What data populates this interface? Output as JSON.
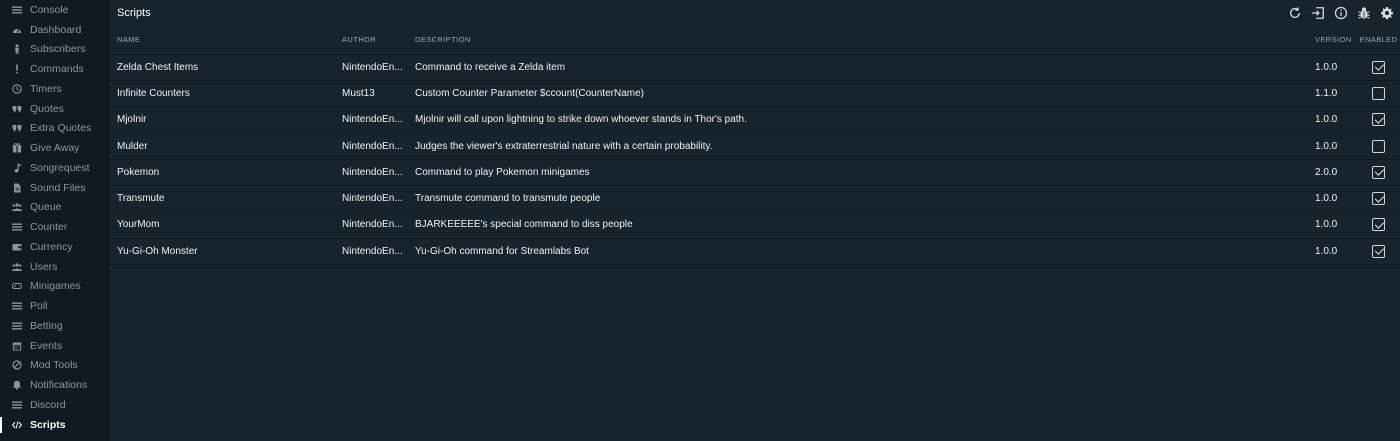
{
  "sidebar": {
    "items": [
      {
        "label": "Console",
        "icon": "menu-icon",
        "active": false
      },
      {
        "label": "Dashboard",
        "icon": "dashboard-icon",
        "active": false
      },
      {
        "label": "Subscribers",
        "icon": "person-icon",
        "active": false
      },
      {
        "label": "Commands",
        "icon": "exclamation-icon",
        "active": false
      },
      {
        "label": "Timers",
        "icon": "clock-icon",
        "active": false
      },
      {
        "label": "Quotes",
        "icon": "quote-icon",
        "active": false
      },
      {
        "label": "Extra Quotes",
        "icon": "quote-icon",
        "active": false
      },
      {
        "label": "Give Away",
        "icon": "gift-icon",
        "active": false
      },
      {
        "label": "Songrequest",
        "icon": "music-note-icon",
        "active": false
      },
      {
        "label": "Sound Files",
        "icon": "file-icon",
        "active": false
      },
      {
        "label": "Queue",
        "icon": "group-icon",
        "active": false
      },
      {
        "label": "Counter",
        "icon": "menu-icon",
        "active": false
      },
      {
        "label": "Currency",
        "icon": "wallet-icon",
        "active": false
      },
      {
        "label": "Users",
        "icon": "group-icon",
        "active": false
      },
      {
        "label": "Minigames",
        "icon": "gamepad-icon",
        "active": false
      },
      {
        "label": "Poll",
        "icon": "menu-icon",
        "active": false
      },
      {
        "label": "Betting",
        "icon": "menu-icon",
        "active": false
      },
      {
        "label": "Events",
        "icon": "calendar-icon",
        "active": false
      },
      {
        "label": "Mod Tools",
        "icon": "block-icon",
        "active": false
      },
      {
        "label": "Notifications",
        "icon": "bell-icon",
        "active": false
      },
      {
        "label": "Discord",
        "icon": "menu-icon",
        "active": false
      },
      {
        "label": "Scripts",
        "icon": "code-icon",
        "active": true
      }
    ]
  },
  "header": {
    "title": "Scripts",
    "tools": [
      "reload-icon",
      "import-icon",
      "info-icon",
      "bug-icon",
      "settings-gear-icon"
    ]
  },
  "table": {
    "columns": {
      "name": "NAME",
      "author": "AUTHOR",
      "description": "DESCRIPTION",
      "version": "VERSION",
      "enabled": "ENABLED"
    },
    "rows": [
      {
        "name": "Zelda Chest Items",
        "author": "NintendoEn...",
        "description": "Command to receive a Zelda item",
        "version": "1.0.0",
        "enabled": true
      },
      {
        "name": "Infinite Counters",
        "author": "Must13",
        "description": "Custom Counter Parameter $ccount(CounterName)",
        "version": "1.1.0",
        "enabled": false
      },
      {
        "name": "Mjolnir",
        "author": "NintendoEn...",
        "description": "Mjolnir will call upon lightning to strike down whoever stands in Thor's path.",
        "version": "1.0.0",
        "enabled": true
      },
      {
        "name": "Mulder",
        "author": "NintendoEn...",
        "description": "Judges the viewer's extraterrestrial nature with a certain probability.",
        "version": "1.0.0",
        "enabled": false
      },
      {
        "name": "Pokemon",
        "author": "NintendoEn...",
        "description": "Command to play Pokemon minigames",
        "version": "2.0.0",
        "enabled": true
      },
      {
        "name": "Transmute",
        "author": "NintendoEn...",
        "description": "Transmute command to transmute people",
        "version": "1.0.0",
        "enabled": true
      },
      {
        "name": "YourMom",
        "author": "NintendoEn...",
        "description": "BJARKEEEEE's special command to diss people",
        "version": "1.0.0",
        "enabled": true
      },
      {
        "name": "Yu-Gi-Oh Monster",
        "author": "NintendoEn...",
        "description": "Yu-Gi-Oh command for Streamlabs Bot",
        "version": "1.0.0",
        "enabled": true
      }
    ]
  }
}
